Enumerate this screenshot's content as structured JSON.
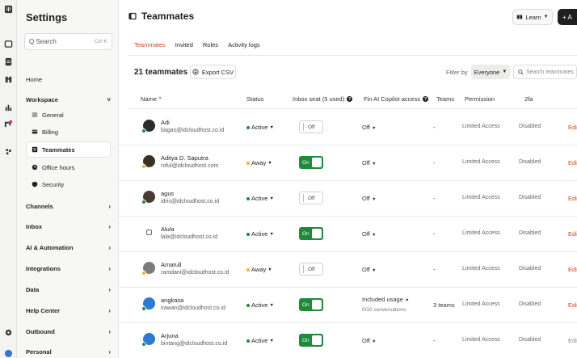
{
  "sidebar": {
    "title": "Settings",
    "search_placeholder": "Q Search",
    "search_shortcut": "Ctrl K",
    "home": "Home",
    "workspace": "Workspace",
    "workspace_items": [
      {
        "label": "General",
        "icon": "menu-icon"
      },
      {
        "label": "Billing",
        "icon": "card-icon"
      },
      {
        "label": "Teammates",
        "icon": "teammates-icon"
      },
      {
        "label": "Office hours",
        "icon": "clock-icon"
      },
      {
        "label": "Security",
        "icon": "shield-icon"
      }
    ],
    "sections": [
      "Channels",
      "Inbox",
      "AI & Automation",
      "Integrations",
      "Data",
      "Help Center",
      "Outbound",
      "Personal"
    ]
  },
  "header": {
    "title": "Teammates",
    "learn_label": "Learn",
    "add_label": "+ A"
  },
  "tabs": [
    "Teammates",
    "Invited",
    "Roles",
    "Activity logs"
  ],
  "toolbar": {
    "count_label": "21 teammates",
    "export_label": "Export CSV",
    "filter_label": "Filter by",
    "filter_value": "Everyone",
    "search_placeholder": "Search teammates"
  },
  "table": {
    "columns": {
      "name": "Name ^",
      "status": "Status",
      "inbox_seat": "Inbox seat (5 used)",
      "copilot": "Fin AI Copilot access",
      "teams": "Teams",
      "permission": "Permission",
      "twofa": "2fa"
    },
    "rows": [
      {
        "name": "Adi",
        "email": "bagas@idcloudhost.co.id",
        "status": "Active",
        "status_color": "#1f8a3a",
        "seat": "Off",
        "seat_on": false,
        "copilot": "Off",
        "copilot_sub": "",
        "teams": "-",
        "permission": "Limited Access",
        "twofa": "Disabled",
        "edit": "Edit",
        "avatar_bg": "#2b2b2b"
      },
      {
        "name": "Aditya D. Saputra",
        "email": "roful@idcloudhost.com",
        "status": "Away",
        "status_color": "#f2b52c",
        "seat": "On",
        "seat_on": true,
        "copilot": "Off",
        "copilot_sub": "",
        "teams": "-",
        "permission": "Limited Access",
        "twofa": "Disabled",
        "edit": "Edit",
        "avatar_bg": "#3a3026"
      },
      {
        "name": "agus",
        "email": "idris@idcloudhost.co.id",
        "status": "Active",
        "status_color": "#1f8a3a",
        "seat": "Off",
        "seat_on": false,
        "copilot": "Off",
        "copilot_sub": "",
        "teams": "-",
        "permission": "Limited Access",
        "twofa": "Disabled",
        "edit": "Edit",
        "avatar_bg": "#4a3b30"
      },
      {
        "name": "Alula",
        "email": "lala@idcloudhost.co.id",
        "status": "Active",
        "status_color": "#1f8a3a",
        "seat": "On",
        "seat_on": true,
        "copilot": "Off",
        "copilot_sub": "",
        "teams": "-",
        "permission": "Limited Access",
        "twofa": "Disabled",
        "edit": "Edit",
        "avatar_bg": ""
      },
      {
        "name": "Amarull",
        "email": "ramdani@idcloudhost.co.id",
        "status": "Away",
        "status_color": "#f2b52c",
        "seat": "Off",
        "seat_on": false,
        "copilot": "Off",
        "copilot_sub": "",
        "teams": "-",
        "permission": "Limited Access",
        "twofa": "Disabled",
        "edit": "Edit",
        "avatar_bg": "#7b7b7b"
      },
      {
        "name": "angkasa",
        "email": "irawan@idcloudhost.co.id",
        "status": "Active",
        "status_color": "#1f8a3a",
        "seat": "On",
        "seat_on": true,
        "copilot": "Included usage",
        "copilot_sub": "0/10 conversations",
        "teams": "3 teams",
        "permission": "Limited Access",
        "twofa": "Disabled",
        "edit": "Edit",
        "avatar_bg": "#2e79d6"
      },
      {
        "name": "Arjuna",
        "email": "bintang@idcloudhost.co.id",
        "status": "Active",
        "status_color": "#1f8a3a",
        "seat": "On",
        "seat_on": true,
        "copilot": "Off",
        "copilot_sub": "",
        "teams": "-",
        "permission": "Limited Access",
        "twofa": "Disabled",
        "edit": "Edit",
        "avatar_bg": "#2e79d6"
      }
    ]
  }
}
